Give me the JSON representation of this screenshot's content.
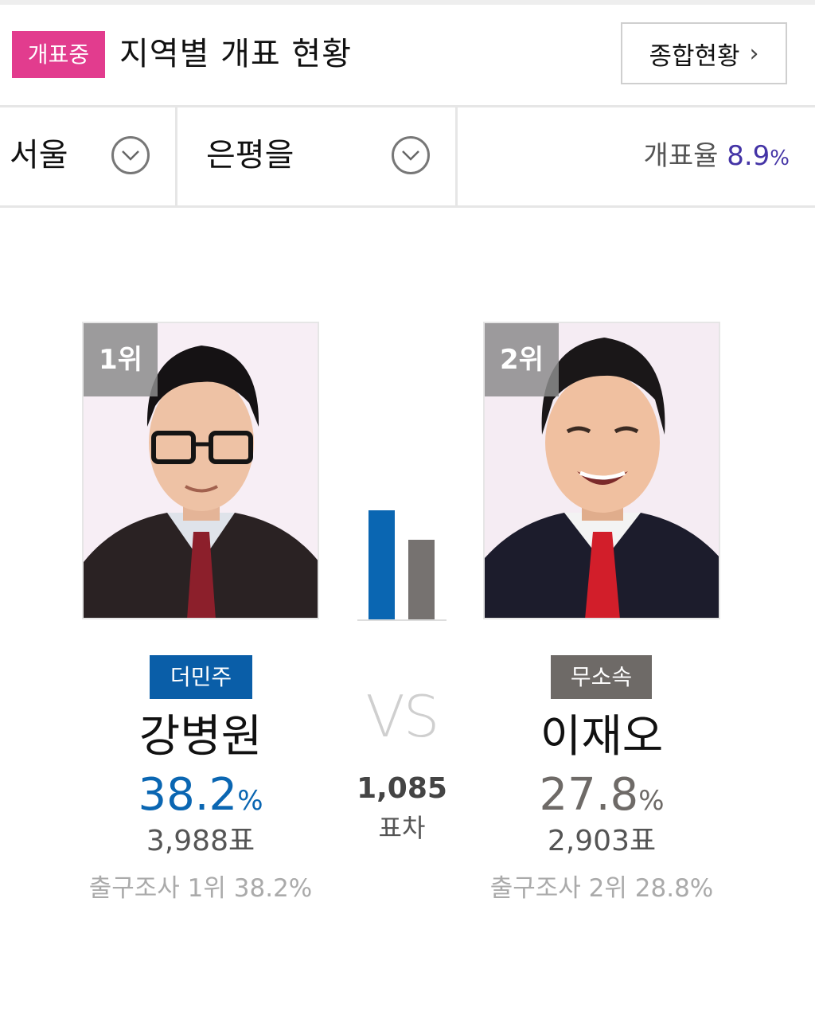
{
  "header": {
    "status_badge": "개표중",
    "title": "지역별 개표 현황",
    "summary_button": "종합현황",
    "summary_chevron": "›"
  },
  "selectors": {
    "city": "서울",
    "district": "은평을",
    "count_rate_label": "개표율",
    "count_rate_value": "8.9",
    "count_rate_unit": "%"
  },
  "candidates": [
    {
      "rank": "1위",
      "party": "더민주",
      "party_color": "#0a5ea8",
      "name": "강병원",
      "percent": "38.2",
      "percent_unit": "%",
      "votes": "3,988표",
      "exit_poll": "출구조사 1위 38.2%",
      "vote_share": 38.2
    },
    {
      "rank": "2위",
      "party": "무소속",
      "party_color": "#6e6a67",
      "name": "이재오",
      "percent": "27.8",
      "percent_unit": "%",
      "votes": "2,903표",
      "exit_poll": "출구조사 2위 28.8%",
      "vote_share": 27.8
    }
  ],
  "comparison": {
    "vs": "VS",
    "difference": "1,085",
    "difference_label": "표차"
  }
}
